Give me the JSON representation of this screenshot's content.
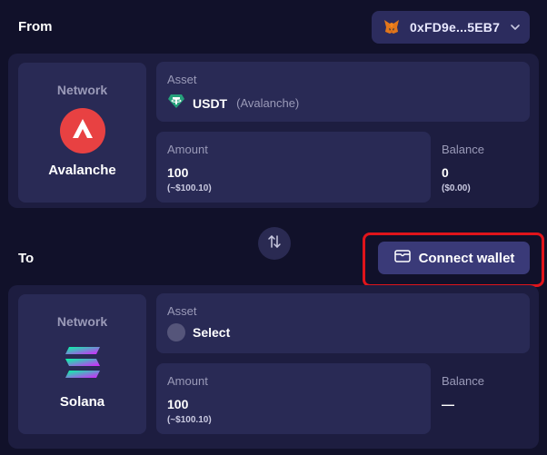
{
  "from": {
    "label": "From",
    "wallet": {
      "address": "0xFD9e...5EB7",
      "icon": "metamask-fox-icon"
    },
    "network": {
      "caption": "Network",
      "name": "Avalanche",
      "color": "#e84142"
    },
    "asset": {
      "caption": "Asset",
      "symbol": "USDT",
      "chain": "(Avalanche)",
      "icon": "tether-icon"
    },
    "amount": {
      "caption": "Amount",
      "value": "100",
      "fiat": "(~$100.10)"
    },
    "balance": {
      "caption": "Balance",
      "value": "0",
      "fiat": "($0.00)"
    }
  },
  "swap": {
    "icon": "swap-arrows-icon"
  },
  "to": {
    "label": "To",
    "connect_label": "Connect wallet",
    "network": {
      "caption": "Network",
      "name": "Solana"
    },
    "asset": {
      "caption": "Asset",
      "placeholder": "Select"
    },
    "amount": {
      "caption": "Amount",
      "value": "100",
      "fiat": "(~$100.10)"
    },
    "balance": {
      "caption": "Balance",
      "value": "—"
    }
  }
}
